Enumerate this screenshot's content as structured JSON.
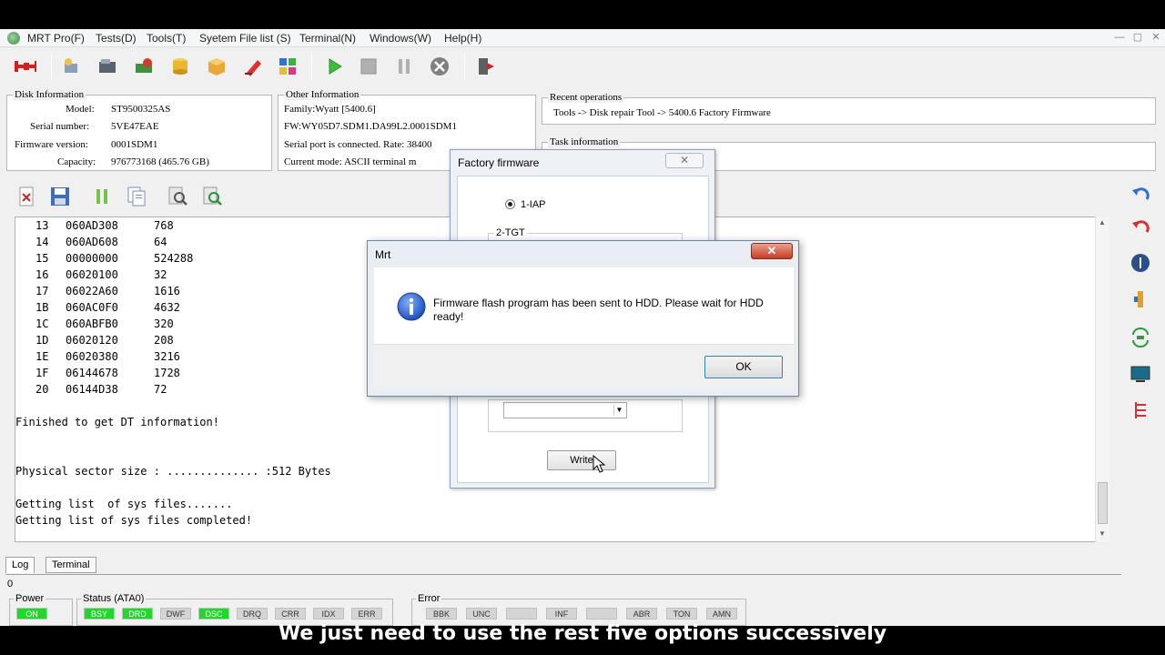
{
  "menubar": {
    "items": [
      "MRT Pro(F)",
      "Tests(D)",
      "Tools(T)",
      "Syetem File list (S)",
      "Terminal(N)",
      "Windows(W)",
      "Help(H)"
    ]
  },
  "window_controls": {
    "minimize": "—",
    "restore": "▢",
    "close": "✕"
  },
  "disk_info": {
    "title": "Disk Information",
    "model_label": "Model:",
    "model": "ST9500325AS",
    "serial_label": "Serial number:",
    "serial": "5VE47EAE",
    "firmware_label": "Firmware version:",
    "firmware": "0001SDM1",
    "capacity_label": "Capacity:",
    "capacity": "976773168 (465.76 GB)"
  },
  "other_info": {
    "title": "Other Information",
    "family": "Family:Wyatt [5400.6]",
    "fw": "FW:WY05D7.SDM1.DA99L2.0001SDM1",
    "serial_port": "Serial port is connected. Rate: 38400",
    "mode": "Current mode: ASCII terminal m"
  },
  "recent_ops": {
    "title": "Recent operations",
    "text": "Tools -> Disk repair Tool -> 5400.6 Factory Firmware"
  },
  "task_info": {
    "title": "Task information"
  },
  "log": {
    "dt_rows": [
      [
        "13",
        "060AD308",
        "768"
      ],
      [
        "14",
        "060AD608",
        "64"
      ],
      [
        "15",
        "00000000",
        "524288"
      ],
      [
        "16",
        "06020100",
        "32"
      ],
      [
        "17",
        "06022A60",
        "1616"
      ],
      [
        "1B",
        "060AC0F0",
        "4632"
      ],
      [
        "1C",
        "060ABFB0",
        "320"
      ],
      [
        "1D",
        "06020120",
        "208"
      ],
      [
        "1E",
        "06020380",
        "3216"
      ],
      [
        "1F",
        "06144678",
        "1728"
      ],
      [
        "20",
        "06144D38",
        "72"
      ]
    ],
    "finished": "Finished to get DT information!",
    "sector": "Physical sector size : .............. :512 Bytes",
    "getting": "Getting list  of sys files.......",
    "completed": "Getting list of sys files completed!"
  },
  "tabs": {
    "log": "Log",
    "terminal": "Terminal"
  },
  "status_value": "0",
  "status": {
    "power_title": "Power",
    "power_on": "ON",
    "status_title": "Status (ATA0)",
    "status_flags": [
      "BSY",
      "DRD",
      "DWF",
      "DSC",
      "DRQ",
      "CRR",
      "IDX",
      "ERR"
    ],
    "status_on": [
      true,
      true,
      false,
      true,
      false,
      false,
      false,
      false
    ],
    "error_title": "Error",
    "error_flags": [
      "BBK",
      "UNC",
      "",
      "INF",
      "",
      "ABR",
      "TON",
      "AMN"
    ]
  },
  "factory_dialog": {
    "title": "Factory firmware",
    "close": "✕",
    "option1": "1-IAP",
    "option2": "2-TGT",
    "write": "Write"
  },
  "mrt_dialog": {
    "title": "Mrt",
    "close": "✕",
    "message": "Firmware flash program has been sent to HDD. Please wait for HDD ready!",
    "ok": "OK"
  },
  "subtitle": "We just need to use the rest five options successively"
}
